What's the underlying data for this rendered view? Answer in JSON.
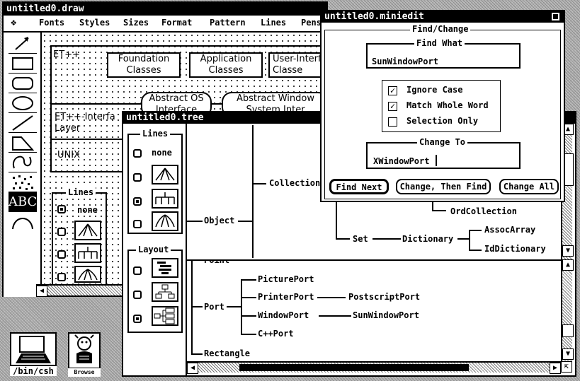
{
  "draw_window": {
    "title": "untitled0.draw",
    "menus": [
      "Fonts",
      "Styles",
      "Sizes",
      "Format",
      "Pattern",
      "Lines",
      "Pens"
    ],
    "tools_text": "ABC",
    "boxes": {
      "etpp": "ET++",
      "foundation": "Foundation Classes",
      "application": "Application Classes",
      "user_interface": "User-Interf Classe",
      "abstract_os": "Abstract OS Interface",
      "abstract_ws": "Abstract Window System Inter",
      "etpp_interface": "ET++-Interfa Layer",
      "unix": "UNIX"
    },
    "lines_panel": {
      "title": "Lines",
      "none_label": "none"
    }
  },
  "tree_window": {
    "title": "untitled0.tree",
    "lines_title": "Lines",
    "none_label": "none",
    "layout_title": "Layout",
    "nodes": {
      "object": "Object",
      "collection": "Collection",
      "ordcollection": "OrdCollection",
      "set": "Set",
      "dictionary": "Dictionary",
      "assocarray": "AssocArray",
      "iddictionary": "IdDictionary",
      "point": "Point",
      "port": "Port",
      "pictureport": "PicturePort",
      "printerport": "PrinterPort",
      "postscriptport": "PostscriptPort",
      "windowport": "WindowPort",
      "sunwindowport": "SunWindowPort",
      "cppport": "C++Port",
      "rectangle": "Rectangle"
    }
  },
  "miniedit_window": {
    "title": "untitled0.miniedit",
    "find_change_title": "Find/Change",
    "find_what_title": "Find What",
    "find_value": "SunWindowPort",
    "options": [
      {
        "label": "Ignore Case",
        "checked": true
      },
      {
        "label": "Match Whole Word",
        "checked": true
      },
      {
        "label": "Selection Only",
        "checked": false
      }
    ],
    "change_to_title": "Change To",
    "change_value": "XWindowPort",
    "buttons": {
      "find_next": "Find Next",
      "change_then_find": "Change, Then Find",
      "change_all": "Change All"
    }
  },
  "desktop": {
    "bin_csh_label": "/bin/csh",
    "browse_label": "Browse"
  }
}
